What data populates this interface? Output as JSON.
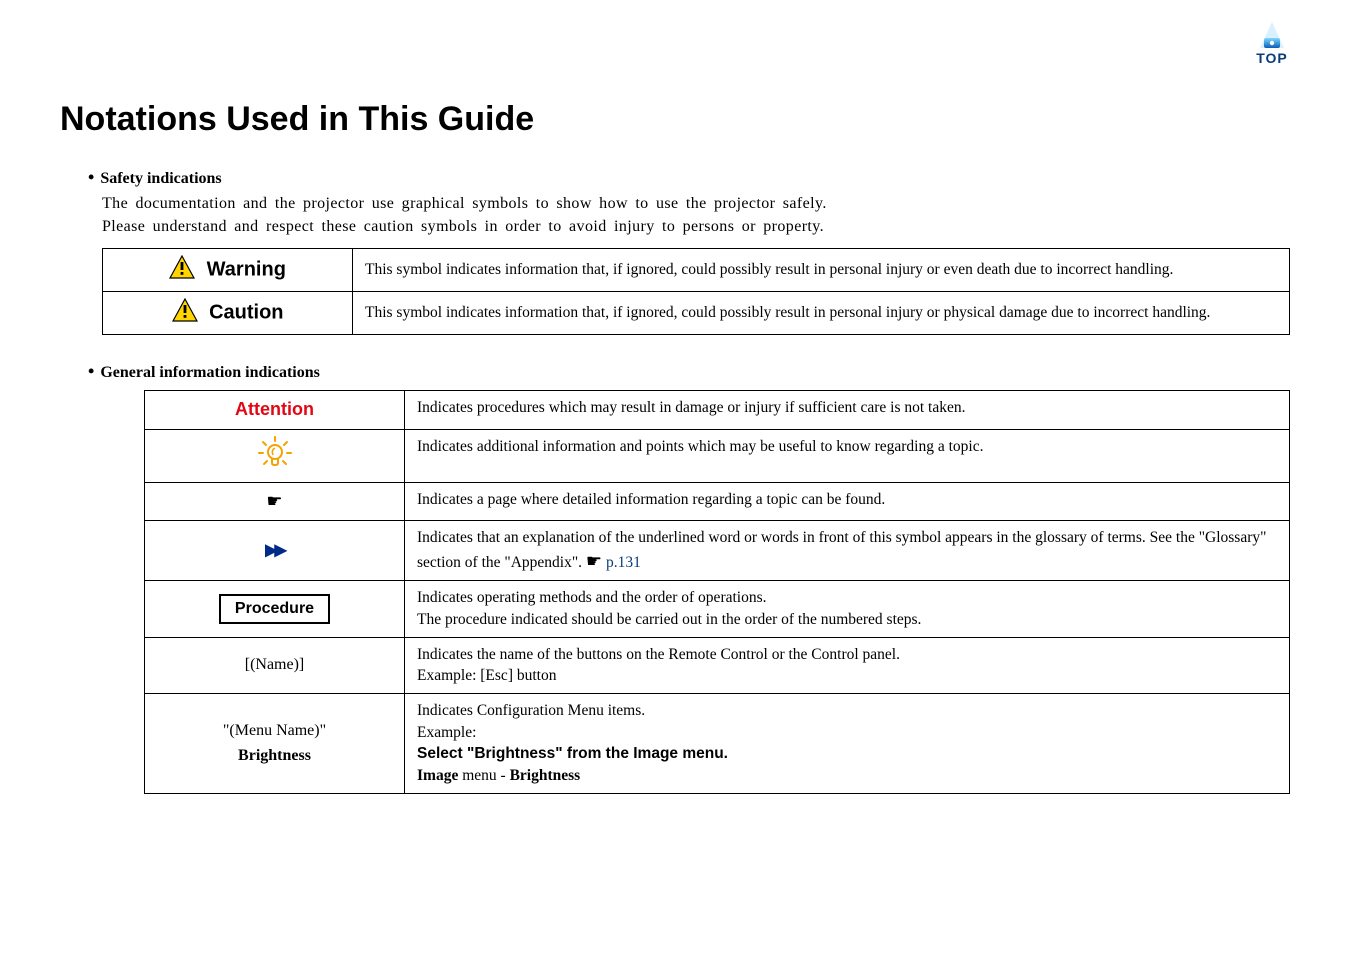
{
  "logo": {
    "text": "TOP"
  },
  "page_title": "Notations Used in This Guide",
  "safety_section": {
    "heading": "Safety indications",
    "intro_line1": "The documentation and the projector use graphical symbols to show how to use the projector safely.",
    "intro_line2": "Please understand and respect these caution symbols in order to avoid injury to persons or property.",
    "rows": [
      {
        "label": "Warning",
        "desc": "This symbol indicates information that, if ignored, could possibly result in personal injury or even death due to incorrect handling."
      },
      {
        "label": "Caution",
        "desc": "This symbol indicates information that, if ignored, could possibly result in personal injury or physical damage due to incorrect handling."
      }
    ]
  },
  "general_section": {
    "heading": "General information indications",
    "rows": {
      "attention": {
        "label": "Attention",
        "desc": "Indicates procedures which may result in damage or injury if sufficient care is not taken."
      },
      "tip": {
        "desc": "Indicates additional information and points which may be useful to know regarding a topic."
      },
      "page": {
        "desc": "Indicates a page where detailed information regarding a topic can be found."
      },
      "glossary": {
        "desc_pre": "Indicates that an explanation of the underlined word or words in front of this symbol appears in the glossary of terms. See the \"Glossary\" section of the \"Appendix\". ",
        "link": "p.131"
      },
      "procedure": {
        "label": "Procedure",
        "line1": "Indicates operating methods and the order of operations.",
        "line2": "The procedure indicated should be carried out in the order of the numbered steps."
      },
      "name": {
        "label": "[(Name)]",
        "line1": "Indicates the name of the buttons on the Remote Control or the Control panel.",
        "line2": "Example: [Esc] button"
      },
      "menu": {
        "label1": "\"(Menu Name)\"",
        "label2": "Brightness",
        "line1": "Indicates Configuration Menu items.",
        "line2": "Example:",
        "line3": "Select \"Brightness\" from the Image menu.",
        "line4_a": "Image",
        "line4_b": " menu - ",
        "line4_c": "Brightness"
      }
    }
  }
}
